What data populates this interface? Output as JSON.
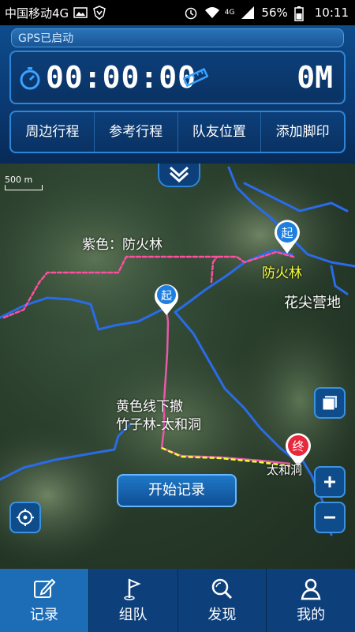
{
  "status": {
    "carrier": "中国移动4G",
    "signal_tag": "4G",
    "battery": "56%",
    "time": "10:11"
  },
  "gps": {
    "status_text": "GPS已启动"
  },
  "timer": {
    "elapsed": "00:00:00",
    "distance": "0M"
  },
  "tabs": [
    {
      "label": "周边行程"
    },
    {
      "label": "参考行程"
    },
    {
      "label": "队友位置"
    },
    {
      "label": "添加脚印"
    }
  ],
  "map": {
    "scale_label": "500 m",
    "labels": {
      "purple": "紫色：防火林",
      "fanghuolin": "防火林",
      "huajian": "花尖营地",
      "yellow_line_1": "黄色线下撤",
      "yellow_line_2": "竹子林-太和洞",
      "taihedong": "太和洞"
    },
    "markers": {
      "start": "起",
      "end": "终"
    },
    "start_button": "开始记录"
  },
  "bottom_nav": [
    {
      "label": "记录",
      "icon": "pencil-icon",
      "active": true
    },
    {
      "label": "组队",
      "icon": "flag-icon"
    },
    {
      "label": "发现",
      "icon": "search-icon"
    },
    {
      "label": "我的",
      "icon": "person-icon"
    }
  ],
  "colors": {
    "panel_blue": "#0e4c8c",
    "track_blue": "#2a6be8",
    "track_pink": "#ff4fa0",
    "track_yellow": "#f6ff3a"
  }
}
